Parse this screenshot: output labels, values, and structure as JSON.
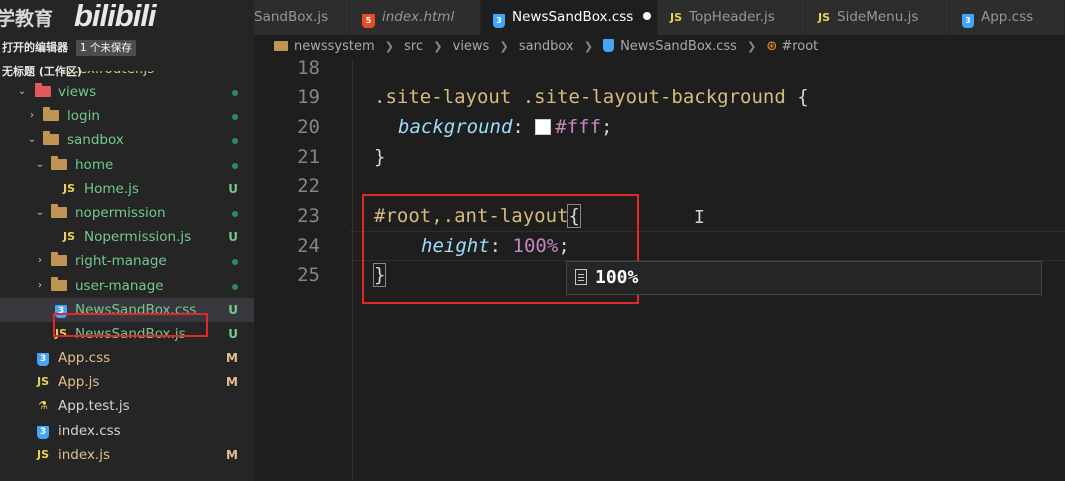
{
  "watermark": {
    "text": "学教育",
    "logo": "bilibili"
  },
  "sidebar": {
    "open_editors_label": "打开的编辑器",
    "unsaved_badge": "1 个未保存",
    "workspace_title": "无标题 (工作区)",
    "items": [
      {
        "name": "index.router.js",
        "kind": "js",
        "status": ""
      },
      {
        "name": "views",
        "kind": "folder-open",
        "status": "dot"
      },
      {
        "name": "login",
        "kind": "folder",
        "status": "dot"
      },
      {
        "name": "sandbox",
        "kind": "folder-open",
        "status": "dot"
      },
      {
        "name": "home",
        "kind": "folder-open",
        "status": "dot"
      },
      {
        "name": "Home.js",
        "kind": "js",
        "status": "U"
      },
      {
        "name": "nopermission",
        "kind": "folder-open",
        "status": "dot"
      },
      {
        "name": "Nopermission.js",
        "kind": "js",
        "status": "U"
      },
      {
        "name": "right-manage",
        "kind": "folder",
        "status": "dot"
      },
      {
        "name": "user-manage",
        "kind": "folder",
        "status": "dot"
      },
      {
        "name": "NewsSandBox.css",
        "kind": "css",
        "status": "U"
      },
      {
        "name": "NewsSandBox.js",
        "kind": "js",
        "status": "U"
      },
      {
        "name": "App.css",
        "kind": "css",
        "status": "M"
      },
      {
        "name": "App.js",
        "kind": "js",
        "status": "M"
      },
      {
        "name": "App.test.js",
        "kind": "test",
        "status": ""
      },
      {
        "name": "index.css",
        "kind": "css",
        "status": ""
      },
      {
        "name": "index.js",
        "kind": "js",
        "status": "M"
      }
    ]
  },
  "tabs": [
    {
      "label": "SandBox.js",
      "kind": "js"
    },
    {
      "label": "index.html",
      "kind": "html"
    },
    {
      "label": "NewsSandBox.css",
      "kind": "css"
    },
    {
      "label": "TopHeader.js",
      "kind": "js"
    },
    {
      "label": "SideMenu.js",
      "kind": "js"
    },
    {
      "label": "App.css",
      "kind": "css"
    }
  ],
  "more_label": "···",
  "breadcrumb": [
    "newssystem",
    "src",
    "views",
    "sandbox",
    "NewsSandBox.css",
    "#root"
  ],
  "editor": {
    "line_numbers": [
      "18",
      "19",
      "20",
      "21",
      "22",
      "23",
      "24",
      "25"
    ],
    "line19_selector": ".site-layout .site-layout-background",
    "line19_brace": " {",
    "line20_prop": "background",
    "line20_colon": ": ",
    "line20_value": "#fff",
    "line20_semi": ";",
    "line21": "}",
    "line23_selector": "#root,.ant-layout",
    "line23_brace": "{",
    "line24_prop": "height",
    "line24_colon": ": ",
    "line24_num": "100",
    "line24_unit": "%",
    "line24_semi": ";",
    "line25": "}",
    "suggestion": "100%",
    "swatch_color": "#ffffff"
  }
}
